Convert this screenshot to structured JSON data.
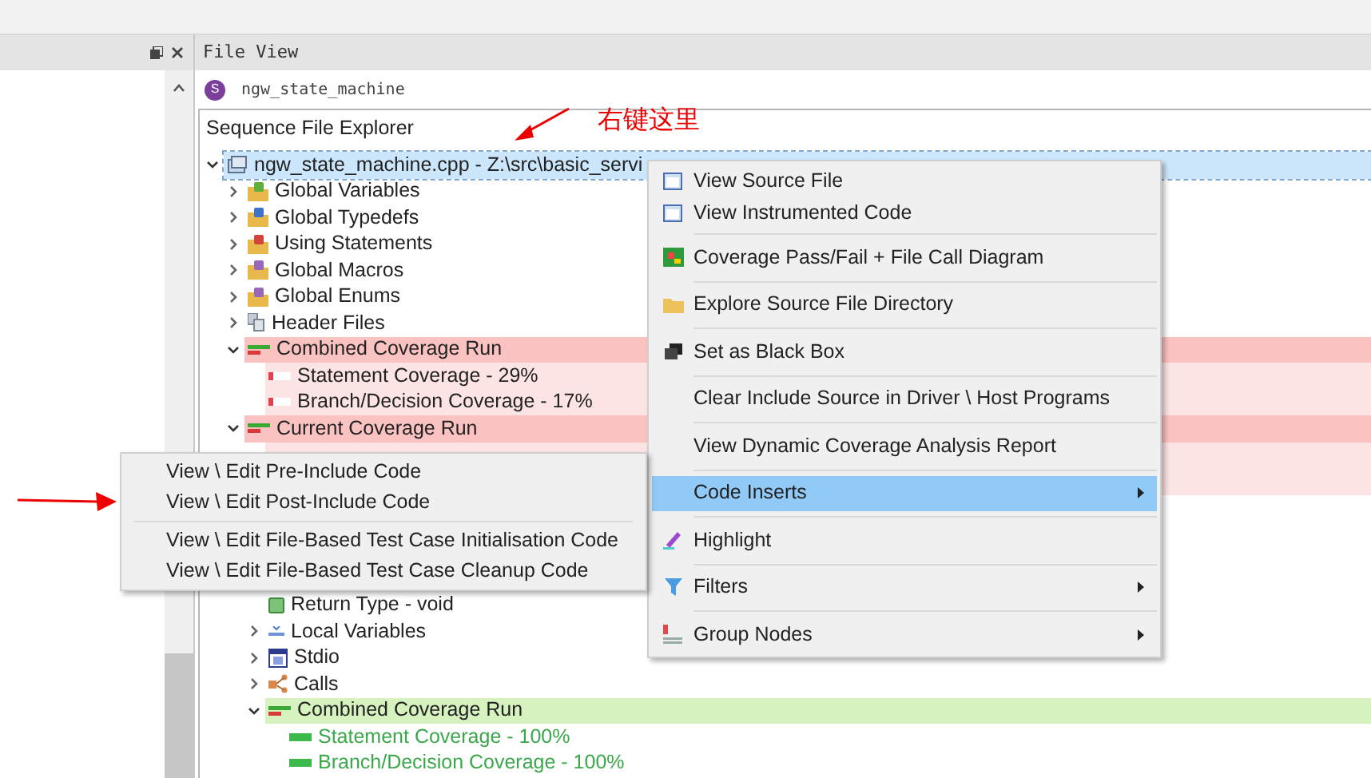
{
  "file_view": {
    "title": "File View",
    "tab": {
      "badge": "S",
      "label": "ngw_state_machine"
    }
  },
  "explorer": {
    "title": "Sequence File Explorer",
    "tree": [
      {
        "label": "ngw_state_machine.cpp - Z:\\src\\basic_servi",
        "kind": "file",
        "expanded": true,
        "selected": true,
        "children": [
          {
            "label": "Global Variables",
            "kind": "variables",
            "expanded": false,
            "selected": false
          },
          {
            "label": "Global Typedefs",
            "kind": "typedefs",
            "expanded": false,
            "selected": false
          },
          {
            "label": "Using Statements",
            "kind": "using",
            "expanded": false,
            "selected": false
          },
          {
            "label": "Global Macros",
            "kind": "macros",
            "expanded": false,
            "selected": false
          },
          {
            "label": "Global Enums",
            "kind": "enums",
            "expanded": false,
            "selected": false
          },
          {
            "label": "Header Files",
            "kind": "headers",
            "expanded": false,
            "selected": false
          },
          {
            "label": "Combined Coverage Run",
            "kind": "failed",
            "expanded": true,
            "selected": false,
            "children": [
              {
                "label": "Statement Coverage - 29%",
                "kind": "low",
                "selected": false
              },
              {
                "label": "Branch/Decision Coverage - 17%",
                "kind": "low",
                "selected": false
              }
            ]
          },
          {
            "label": "Current Coverage Run",
            "kind": "failed",
            "expanded": true,
            "selected": false,
            "children": [
              {
                "label": "Return Type - void",
                "kind": "return",
                "selected": false
              },
              {
                "label": "Local Variables",
                "kind": "locals",
                "expanded": false,
                "selected": false
              },
              {
                "label": "Stdio",
                "kind": "stdio",
                "expanded": false,
                "selected": false
              },
              {
                "label": "Calls",
                "kind": "calls",
                "expanded": false,
                "selected": false
              },
              {
                "label": "Combined Coverage Run",
                "kind": "passed",
                "expanded": true,
                "selected": false,
                "children": [
                  {
                    "label": "Statement Coverage - 100%",
                    "kind": "full",
                    "selected": false
                  },
                  {
                    "label": "Branch/Decision Coverage - 100%",
                    "kind": "full",
                    "selected": false
                  }
                ]
              }
            ]
          }
        ]
      }
    ]
  },
  "context_menu": {
    "groups": [
      [
        {
          "label": "View Source File",
          "kind": "window",
          "selected": false
        },
        {
          "label": "View Instrumented Code",
          "kind": "window",
          "selected": false
        }
      ],
      [
        {
          "label": "Coverage Pass/Fail + File Call Diagram",
          "kind": "chart",
          "selected": false
        }
      ],
      [
        {
          "label": "Explore Source File Directory",
          "kind": "folder",
          "selected": false
        }
      ],
      [
        {
          "label": "Set as Black Box",
          "kind": "boxes",
          "selected": false
        }
      ],
      [
        {
          "label": "Clear Include Source in Driver \\ Host Programs",
          "kind": "plain",
          "selected": false
        }
      ],
      [
        {
          "label": "View Dynamic Coverage Analysis Report",
          "kind": "plain",
          "selected": false
        }
      ],
      [
        {
          "label": "Code Inserts",
          "kind": "submenu",
          "selected": true
        }
      ],
      [
        {
          "label": "Highlight",
          "kind": "pen",
          "selected": false
        }
      ],
      [
        {
          "label": "Filters",
          "kind": "filter-submenu",
          "selected": false
        }
      ],
      [
        {
          "label": "Group Nodes",
          "kind": "group-submenu",
          "selected": false
        }
      ]
    ]
  },
  "submenu": {
    "groups": [
      [
        "View \\ Edit Pre-Include Code",
        "View \\ Edit Post-Include Code"
      ],
      [
        "View \\ Edit File-Based Test Case Initialisation Code",
        "View \\ Edit File-Based Test Case Cleanup Code"
      ]
    ]
  },
  "annotations": [
    {
      "kind": "callout",
      "text": "右键这里"
    },
    {
      "kind": "arrow"
    }
  ]
}
